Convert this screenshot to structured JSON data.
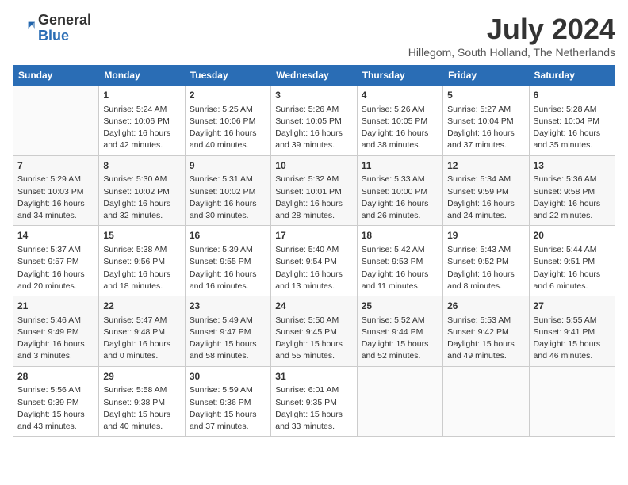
{
  "header": {
    "logo_general": "General",
    "logo_blue": "Blue",
    "month_year": "July 2024",
    "location": "Hillegom, South Holland, The Netherlands"
  },
  "weekdays": [
    "Sunday",
    "Monday",
    "Tuesday",
    "Wednesday",
    "Thursday",
    "Friday",
    "Saturday"
  ],
  "weeks": [
    [
      {
        "day": "",
        "info": ""
      },
      {
        "day": "1",
        "info": "Sunrise: 5:24 AM\nSunset: 10:06 PM\nDaylight: 16 hours\nand 42 minutes."
      },
      {
        "day": "2",
        "info": "Sunrise: 5:25 AM\nSunset: 10:06 PM\nDaylight: 16 hours\nand 40 minutes."
      },
      {
        "day": "3",
        "info": "Sunrise: 5:26 AM\nSunset: 10:05 PM\nDaylight: 16 hours\nand 39 minutes."
      },
      {
        "day": "4",
        "info": "Sunrise: 5:26 AM\nSunset: 10:05 PM\nDaylight: 16 hours\nand 38 minutes."
      },
      {
        "day": "5",
        "info": "Sunrise: 5:27 AM\nSunset: 10:04 PM\nDaylight: 16 hours\nand 37 minutes."
      },
      {
        "day": "6",
        "info": "Sunrise: 5:28 AM\nSunset: 10:04 PM\nDaylight: 16 hours\nand 35 minutes."
      }
    ],
    [
      {
        "day": "7",
        "info": "Sunrise: 5:29 AM\nSunset: 10:03 PM\nDaylight: 16 hours\nand 34 minutes."
      },
      {
        "day": "8",
        "info": "Sunrise: 5:30 AM\nSunset: 10:02 PM\nDaylight: 16 hours\nand 32 minutes."
      },
      {
        "day": "9",
        "info": "Sunrise: 5:31 AM\nSunset: 10:02 PM\nDaylight: 16 hours\nand 30 minutes."
      },
      {
        "day": "10",
        "info": "Sunrise: 5:32 AM\nSunset: 10:01 PM\nDaylight: 16 hours\nand 28 minutes."
      },
      {
        "day": "11",
        "info": "Sunrise: 5:33 AM\nSunset: 10:00 PM\nDaylight: 16 hours\nand 26 minutes."
      },
      {
        "day": "12",
        "info": "Sunrise: 5:34 AM\nSunset: 9:59 PM\nDaylight: 16 hours\nand 24 minutes."
      },
      {
        "day": "13",
        "info": "Sunrise: 5:36 AM\nSunset: 9:58 PM\nDaylight: 16 hours\nand 22 minutes."
      }
    ],
    [
      {
        "day": "14",
        "info": "Sunrise: 5:37 AM\nSunset: 9:57 PM\nDaylight: 16 hours\nand 20 minutes."
      },
      {
        "day": "15",
        "info": "Sunrise: 5:38 AM\nSunset: 9:56 PM\nDaylight: 16 hours\nand 18 minutes."
      },
      {
        "day": "16",
        "info": "Sunrise: 5:39 AM\nSunset: 9:55 PM\nDaylight: 16 hours\nand 16 minutes."
      },
      {
        "day": "17",
        "info": "Sunrise: 5:40 AM\nSunset: 9:54 PM\nDaylight: 16 hours\nand 13 minutes."
      },
      {
        "day": "18",
        "info": "Sunrise: 5:42 AM\nSunset: 9:53 PM\nDaylight: 16 hours\nand 11 minutes."
      },
      {
        "day": "19",
        "info": "Sunrise: 5:43 AM\nSunset: 9:52 PM\nDaylight: 16 hours\nand 8 minutes."
      },
      {
        "day": "20",
        "info": "Sunrise: 5:44 AM\nSunset: 9:51 PM\nDaylight: 16 hours\nand 6 minutes."
      }
    ],
    [
      {
        "day": "21",
        "info": "Sunrise: 5:46 AM\nSunset: 9:49 PM\nDaylight: 16 hours\nand 3 minutes."
      },
      {
        "day": "22",
        "info": "Sunrise: 5:47 AM\nSunset: 9:48 PM\nDaylight: 16 hours\nand 0 minutes."
      },
      {
        "day": "23",
        "info": "Sunrise: 5:49 AM\nSunset: 9:47 PM\nDaylight: 15 hours\nand 58 minutes."
      },
      {
        "day": "24",
        "info": "Sunrise: 5:50 AM\nSunset: 9:45 PM\nDaylight: 15 hours\nand 55 minutes."
      },
      {
        "day": "25",
        "info": "Sunrise: 5:52 AM\nSunset: 9:44 PM\nDaylight: 15 hours\nand 52 minutes."
      },
      {
        "day": "26",
        "info": "Sunrise: 5:53 AM\nSunset: 9:42 PM\nDaylight: 15 hours\nand 49 minutes."
      },
      {
        "day": "27",
        "info": "Sunrise: 5:55 AM\nSunset: 9:41 PM\nDaylight: 15 hours\nand 46 minutes."
      }
    ],
    [
      {
        "day": "28",
        "info": "Sunrise: 5:56 AM\nSunset: 9:39 PM\nDaylight: 15 hours\nand 43 minutes."
      },
      {
        "day": "29",
        "info": "Sunrise: 5:58 AM\nSunset: 9:38 PM\nDaylight: 15 hours\nand 40 minutes."
      },
      {
        "day": "30",
        "info": "Sunrise: 5:59 AM\nSunset: 9:36 PM\nDaylight: 15 hours\nand 37 minutes."
      },
      {
        "day": "31",
        "info": "Sunrise: 6:01 AM\nSunset: 9:35 PM\nDaylight: 15 hours\nand 33 minutes."
      },
      {
        "day": "",
        "info": ""
      },
      {
        "day": "",
        "info": ""
      },
      {
        "day": "",
        "info": ""
      }
    ]
  ]
}
